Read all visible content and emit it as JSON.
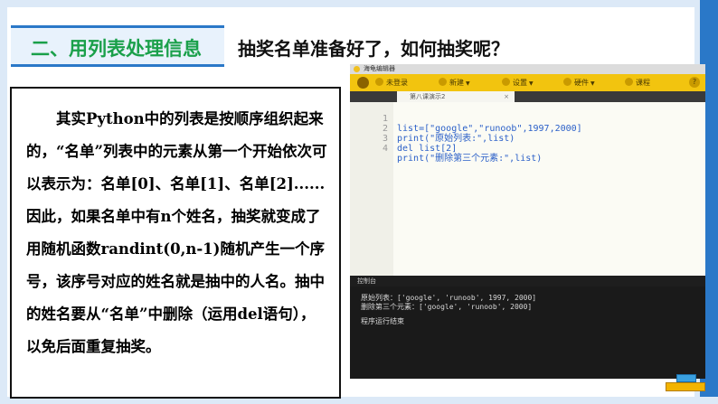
{
  "slide": {
    "heading": "二、用列表处理信息",
    "question": "抽奖名单准备好了，如何抽奖呢？",
    "body_text": "其实Python中的列表是按顺序组织起来的，“名单”列表中的元素从第一个开始依次可以表示为：名单[0]、名单[1]、名单[2]......因此，如果名单中有n个姓名，抽奖就变成了用随机函数randint(0,n-1)随机产生一个序号，该序号对应的姓名就是抽中的人名。抽中的姓名要从“名单”中删除（运用del语句），以免后面重复抽奖。"
  },
  "ide": {
    "app_title": "海龟编辑器",
    "toolbar": {
      "login": "未登录",
      "new": "新建",
      "settings": "设置",
      "hardware": "硬件",
      "course": "课程",
      "help_icon": "help-icon"
    },
    "tab": {
      "label": "第八课演示2",
      "close": "×"
    },
    "code_lines": [
      {
        "num": "1",
        "text": "list=[\"google\",\"runoob\",1997,2000]"
      },
      {
        "num": "2",
        "text": "print(\"原始列表:\",list)"
      },
      {
        "num": "3",
        "text": "del list[2]"
      },
      {
        "num": "4",
        "text": "print(\"删除第三个元素:\",list)"
      }
    ],
    "console": {
      "title": "控制台",
      "lines": [
        "原始列表：['google', 'runoob', 1997, 2000]",
        "删除第三个元素：['google', 'runoob', 2000]"
      ],
      "status": "程序运行结束"
    },
    "colors": {
      "toolbar": "#f2c40f",
      "code": "#2a5fc8",
      "accent": "#2a78c8",
      "heading": "#1aa04a"
    }
  }
}
